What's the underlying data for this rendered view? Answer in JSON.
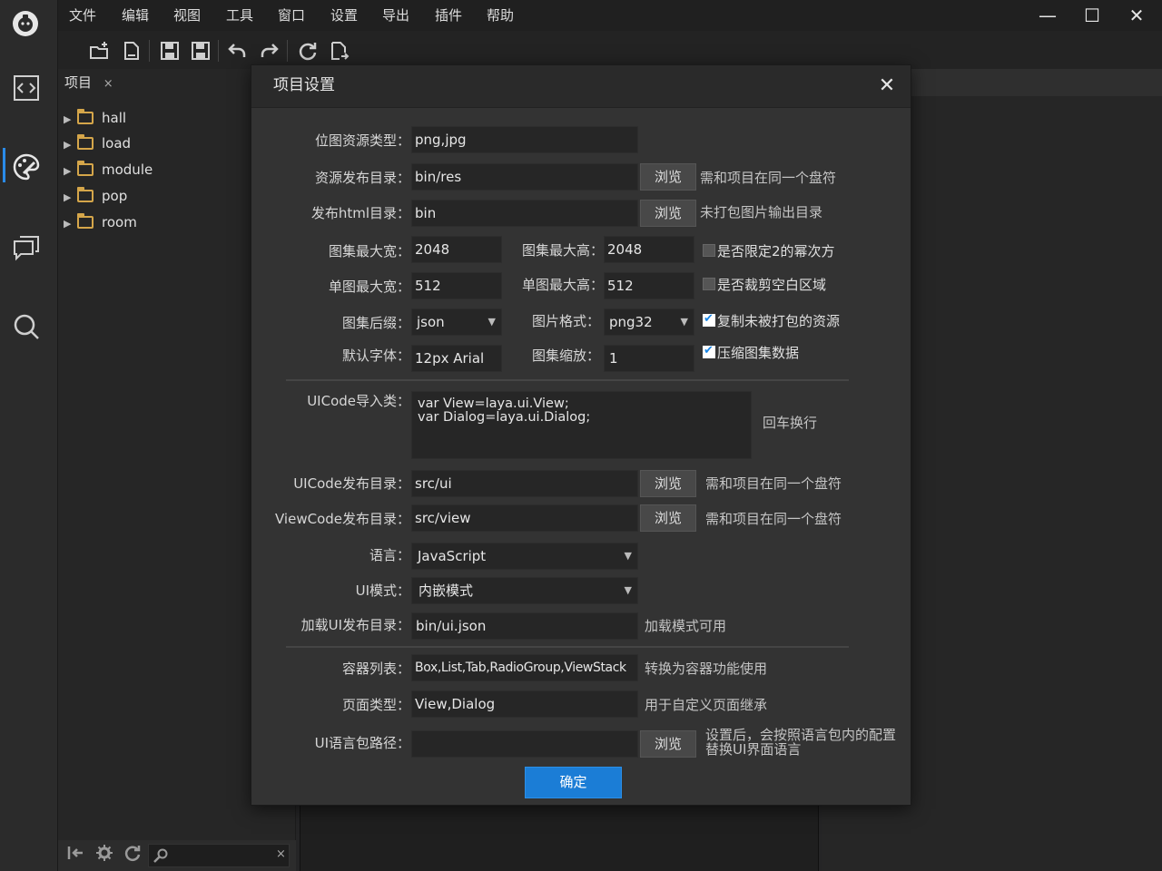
{
  "app": {
    "menu": [
      "文件",
      "编辑",
      "视图",
      "工具",
      "窗口",
      "设置",
      "导出",
      "插件",
      "帮助"
    ],
    "window_controls": {
      "minimize": "—",
      "maximize": "☐",
      "close": "✕"
    }
  },
  "toolbar": {
    "icons": [
      "new-folder-icon",
      "new-file-icon",
      "save-icon",
      "save-all-icon",
      "undo-icon",
      "redo-icon",
      "refresh-icon",
      "export-icon"
    ]
  },
  "sidebar": {
    "icons": [
      "code-icon",
      "palette-icon",
      "chat-icon",
      "search-icon"
    ]
  },
  "project_panel": {
    "tab_label": "项目",
    "tab_close": "×",
    "folders": [
      "hall",
      "load",
      "module",
      "pop",
      "room"
    ],
    "search_close": "×"
  },
  "dialog": {
    "title": "项目设置",
    "close": "✕",
    "browse": "浏览",
    "ok": "确定",
    "fields": {
      "image_types": {
        "label": "位图资源类型：",
        "value": "png,jpg"
      },
      "res_publish": {
        "label": "资源发布目录：",
        "value": "bin/res",
        "hint": "需和项目在同一个盘符"
      },
      "html_publish": {
        "label": "发布html目录：",
        "value": "bin",
        "hint": "未打包图片输出目录"
      },
      "atlas_max_w": {
        "label": "图集最大宽：",
        "value": "2048"
      },
      "atlas_max_h": {
        "label": "图集最大高：",
        "value": "2048"
      },
      "single_max_w": {
        "label": "单图最大宽：",
        "value": "512"
      },
      "single_max_h": {
        "label": "单图最大高：",
        "value": "512"
      },
      "atlas_suffix": {
        "label": "图集后缀：",
        "value": "json"
      },
      "image_format": {
        "label": "图片格式：",
        "value": "png32"
      },
      "default_font": {
        "label": "默认字体：",
        "value": "12px Arial"
      },
      "atlas_scale": {
        "label": "图集缩放：",
        "value": "1"
      },
      "uicode_import": {
        "label": "UICode导入类：",
        "value": "var View=laya.ui.View;\nvar Dialog=laya.ui.Dialog;",
        "hint": "回车换行"
      },
      "uicode_publish": {
        "label": "UICode发布目录：",
        "value": "src/ui",
        "hint": "需和项目在同一个盘符"
      },
      "viewcode_publish": {
        "label": "ViewCode发布目录：",
        "value": "src/view",
        "hint": "需和项目在同一个盘符"
      },
      "language": {
        "label": "语言：",
        "value": "JavaScript"
      },
      "ui_mode": {
        "label": "UI模式：",
        "value": "内嵌模式"
      },
      "load_ui_publish": {
        "label": "加载UI发布目录：",
        "value": "bin/ui.json",
        "hint": "加载模式可用"
      },
      "containers": {
        "label": "容器列表：",
        "value": "Box,List,Tab,RadioGroup,ViewStack",
        "hint": "转换为容器功能使用"
      },
      "page_types": {
        "label": "页面类型：",
        "value": "View,Dialog",
        "hint": "用于自定义页面继承"
      },
      "ui_lang_path": {
        "label": "UI语言包路径：",
        "value": "",
        "hint_line1": "设置后，会按照语言包内的配置",
        "hint_line2": "替换UI界面语言"
      }
    },
    "checkboxes": {
      "power_of_two": {
        "label": "是否限定2的幂次方",
        "checked": false
      },
      "trim_blank": {
        "label": "是否裁剪空白区域",
        "checked": false
      },
      "copy_unpacked": {
        "label": "复制未被打包的资源",
        "checked": true
      },
      "compress_atlas": {
        "label": "压缩图集数据",
        "checked": true
      }
    }
  }
}
